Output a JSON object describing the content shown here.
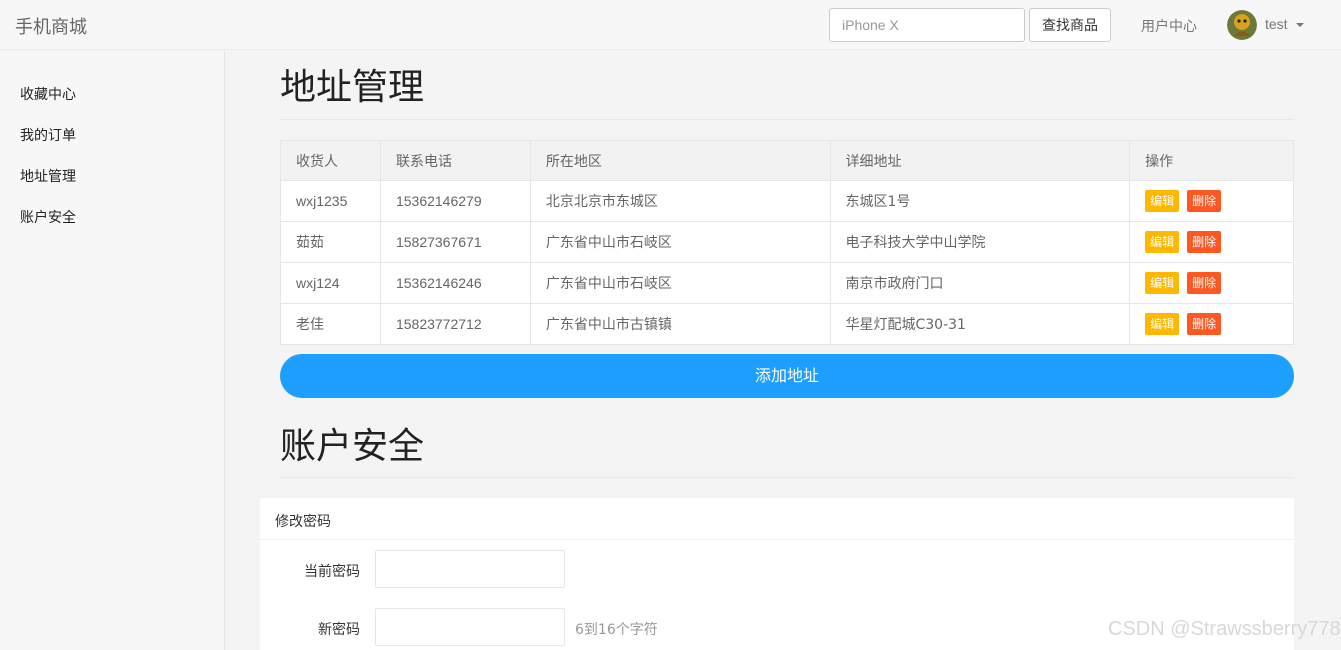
{
  "header": {
    "brand": "手机商城",
    "search": {
      "value": "",
      "placeholder": "iPhone X"
    },
    "search_button": "查找商品",
    "user_center": "用户中心",
    "username": "test"
  },
  "sidebar": {
    "items": [
      {
        "label": "收藏中心"
      },
      {
        "label": "我的订单"
      },
      {
        "label": "地址管理"
      },
      {
        "label": "账户安全"
      }
    ]
  },
  "address": {
    "title": "地址管理",
    "columns": [
      "收货人",
      "联系电话",
      "所在地区",
      "详细地址",
      "操作"
    ],
    "rows": [
      {
        "name": "wxj1235",
        "phone": "15362146279",
        "region": "北京北京市东城区",
        "detail": "东城区1号"
      },
      {
        "name": "茹茹",
        "phone": "15827367671",
        "region": "广东省中山市石岐区",
        "detail": "电子科技大学中山学院"
      },
      {
        "name": "wxj124",
        "phone": "15362146246",
        "region": "广东省中山市石岐区",
        "detail": "南京市政府门口"
      },
      {
        "name": "老佳",
        "phone": "15823772712",
        "region": "广东省中山市古镇镇",
        "detail": "华星灯配城C30-31"
      }
    ],
    "edit_label": "编辑",
    "delete_label": "删除",
    "add_button": "添加地址"
  },
  "security": {
    "title": "账户安全",
    "card_title": "修改密码",
    "current_password_label": "当前密码",
    "new_password_label": "新密码",
    "new_password_hint": "6到16个字符"
  },
  "watermark": "CSDN @Strawssberry778",
  "colors": {
    "primary": "#1e9fff",
    "warm": "#ffb800",
    "danger": "#ff5722"
  }
}
